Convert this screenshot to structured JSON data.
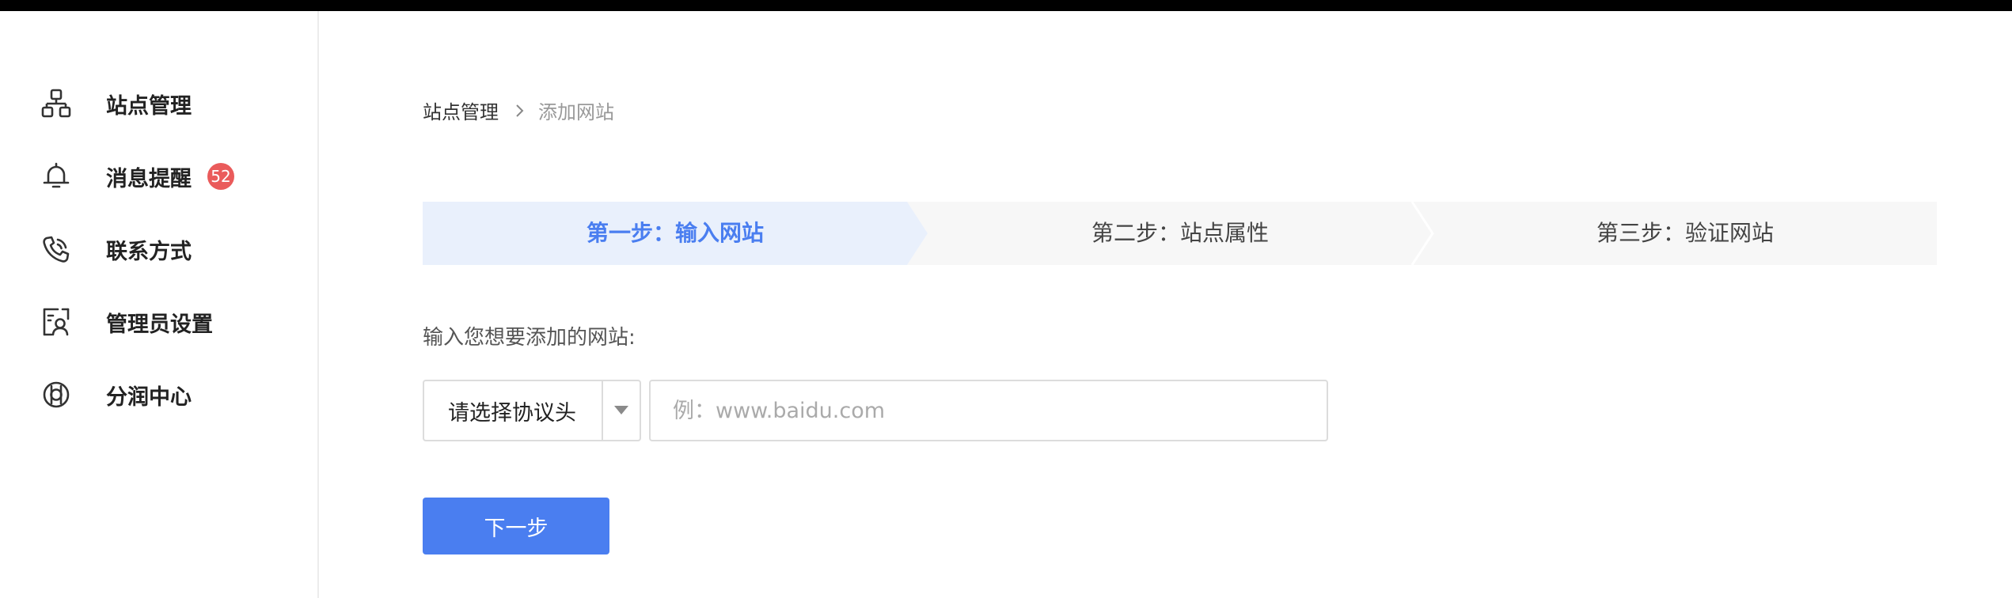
{
  "sidebar": {
    "items": [
      {
        "label": "站点管理",
        "icon": "sitemap-icon"
      },
      {
        "label": "消息提醒",
        "icon": "bell-icon",
        "badge": "52"
      },
      {
        "label": "联系方式",
        "icon": "phone-icon"
      },
      {
        "label": "管理员设置",
        "icon": "admin-user-icon"
      },
      {
        "label": "分润中心",
        "icon": "revenue-share-icon"
      }
    ]
  },
  "breadcrumb": {
    "root": "站点管理",
    "current": "添加网站"
  },
  "steps": [
    {
      "label": "第一步：输入网站",
      "active": true
    },
    {
      "label": "第二步：站点属性",
      "active": false
    },
    {
      "label": "第三步：验证网站",
      "active": false
    }
  ],
  "form": {
    "prompt": "输入您想要添加的网站:",
    "protocol_placeholder": "请选择协议头",
    "url_placeholder": "例：www.baidu.com",
    "url_value": ""
  },
  "next_button": {
    "label": "下一步"
  },
  "colors": {
    "accent": "#4a7ef0",
    "active_step_bg": "#e9f0fc",
    "inactive_step_bg": "#f7f7f7",
    "badge": "#ea5b5b"
  }
}
